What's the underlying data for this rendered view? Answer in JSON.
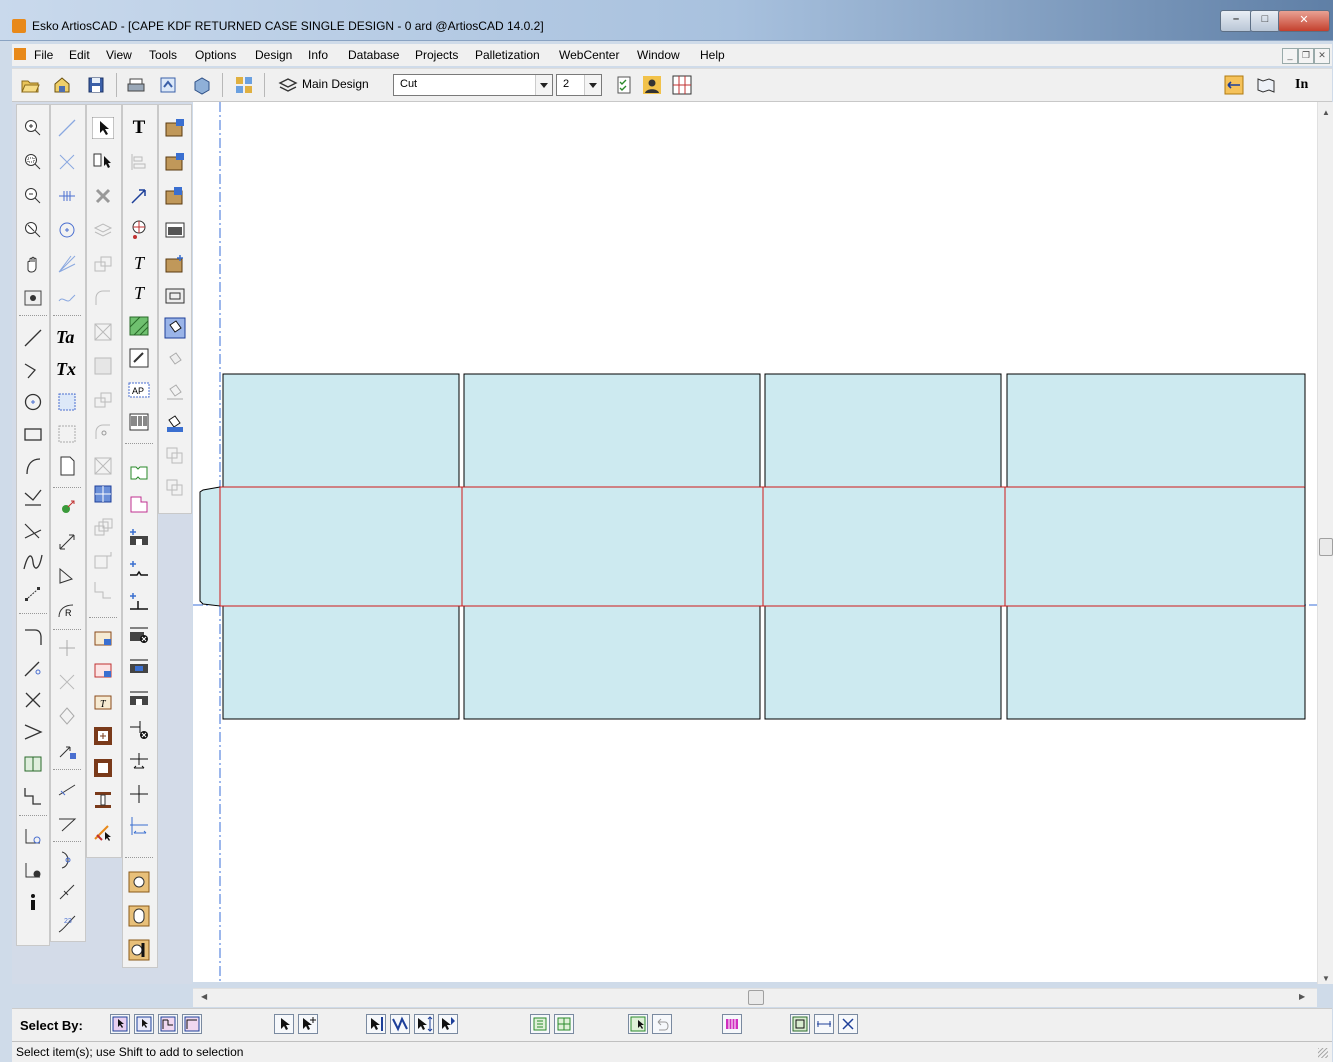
{
  "window": {
    "title": "Esko ArtiosCAD - [CAPE KDF RETURNED CASE SINGLE DESIGN - 0 ard @ArtiosCAD 14.0.2]",
    "min_label": "–",
    "max_label": "□",
    "close_label": "✕"
  },
  "menu": {
    "items": [
      "File",
      "Edit",
      "View",
      "Tools",
      "Options",
      "Design",
      "Info",
      "Database",
      "Projects",
      "Palletization",
      "WebCenter",
      "Window",
      "Help"
    ],
    "mdi_min": "_",
    "mdi_restore": "❐",
    "mdi_close": "✕"
  },
  "toolbar": {
    "main_design_label": "Main Design",
    "layer_value": "Cut",
    "number_value": "2",
    "units_label": "In"
  },
  "select_by": {
    "label": "Select By:"
  },
  "status": {
    "text": "Select item(s); use Shift to add to selection"
  },
  "colors": {
    "panel_fill": "#cdeaf0",
    "cut_line": "#000000",
    "crease_line": "#d01818",
    "guide_line": "#3a6fd8",
    "brand_orange": "#e8891a"
  }
}
